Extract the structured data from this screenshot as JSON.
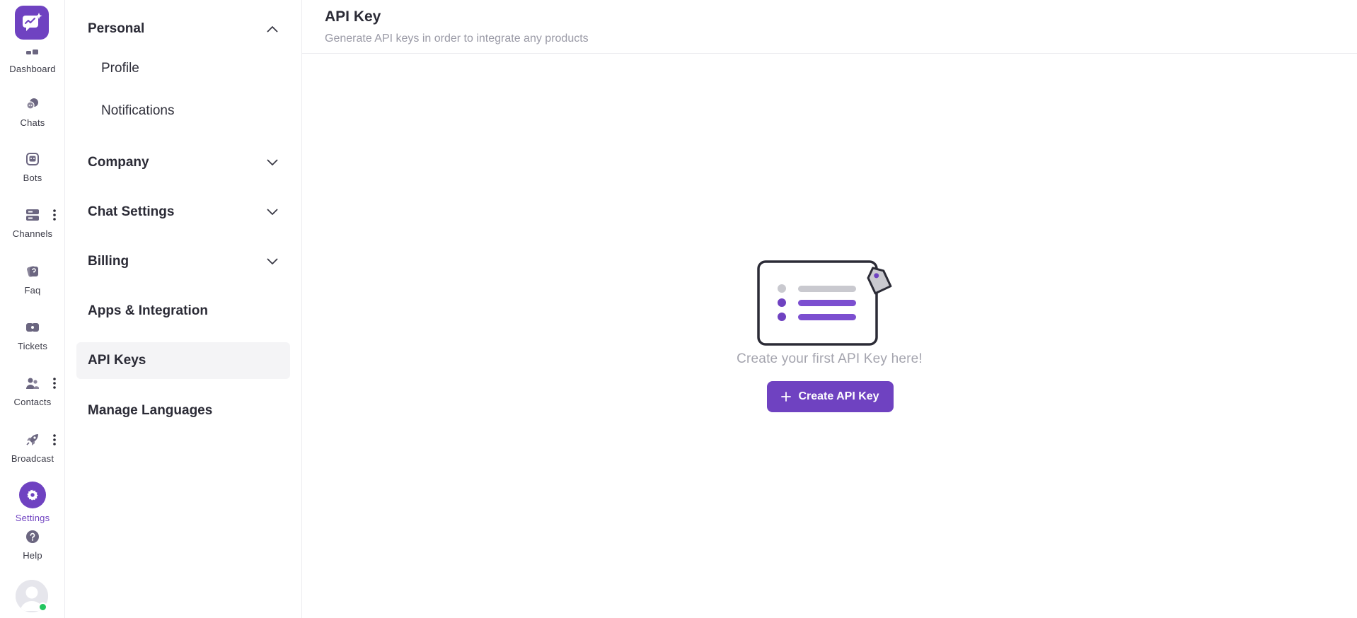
{
  "rail": {
    "items": [
      {
        "label": "Dashboard",
        "icon": "dashboard-icon"
      },
      {
        "label": "Chats",
        "icon": "chat-bubbles-icon"
      },
      {
        "label": "Bots",
        "icon": "bot-icon"
      },
      {
        "label": "Channels",
        "icon": "channels-icon",
        "has_more": true
      },
      {
        "label": "Faq",
        "icon": "faq-icon"
      },
      {
        "label": "Tickets",
        "icon": "ticket-icon"
      },
      {
        "label": "Contacts",
        "icon": "contacts-icon",
        "has_more": true
      },
      {
        "label": "Broadcast",
        "icon": "rocket-icon",
        "has_more": true
      },
      {
        "label": "Settings",
        "icon": "gear-icon",
        "active": true
      },
      {
        "label": "Help",
        "icon": "help-icon"
      }
    ],
    "user_status": "online"
  },
  "menu": {
    "sections": [
      {
        "label": "Personal",
        "expanded": true,
        "children": [
          "Profile",
          "Notifications"
        ]
      },
      {
        "label": "Company",
        "expanded": false
      },
      {
        "label": "Chat Settings",
        "expanded": false
      },
      {
        "label": "Billing",
        "expanded": false
      },
      {
        "label": "Apps & Integration"
      },
      {
        "label": "API Keys",
        "selected": true
      },
      {
        "label": "Manage Languages"
      }
    ]
  },
  "main": {
    "title": "API Key",
    "subtitle": "Generate API keys in order to integrate any products",
    "empty_text": "Create your first API Key here!",
    "create_button_label": "Create API Key"
  },
  "colors": {
    "accent": "#6f42c1",
    "online": "#22c55e",
    "muted_text": "#9a9aa6"
  }
}
